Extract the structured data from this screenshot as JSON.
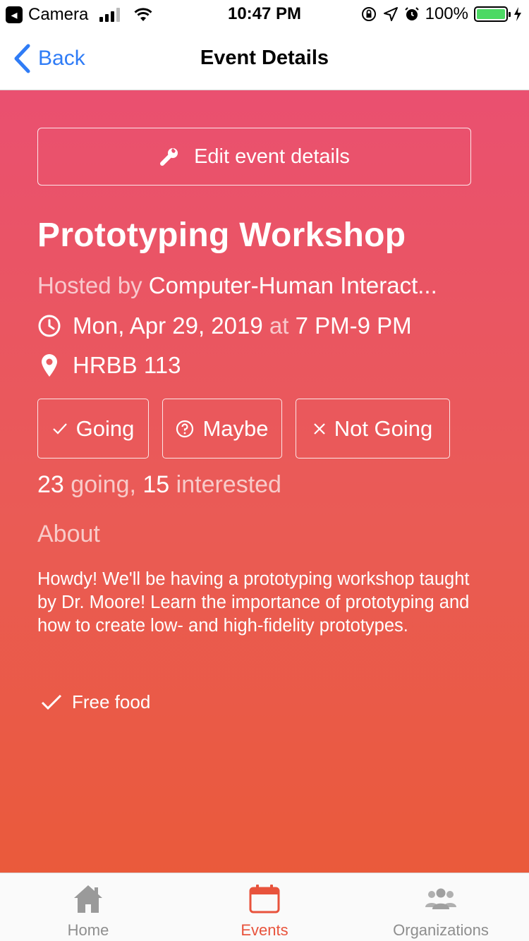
{
  "status_bar": {
    "back_app": "Camera",
    "time": "10:47 PM",
    "battery": "100%",
    "battery_level": 1.0
  },
  "nav": {
    "back_label": "Back",
    "title": "Event Details"
  },
  "event": {
    "edit_button": "Edit event details",
    "title": "Prototyping Workshop",
    "hosted_by_prefix": "Hosted by",
    "host": "Computer-Human Interact...",
    "date": "Mon, Apr 29, 2019",
    "at_word": "at",
    "time": "7 PM-9 PM",
    "location": "HRBB 113",
    "rsvp": {
      "going": "Going",
      "maybe": "Maybe",
      "not_going": "Not Going"
    },
    "going_count": "23",
    "going_word": "going,",
    "interested_count": "15",
    "interested_word": "interested",
    "about_heading": "About",
    "about_text": "Howdy! We'll be having a prototyping workshop taught by Dr. Moore! Learn the importance of prototyping and how to create low- and high-fidelity prototypes.",
    "tags": [
      "Free food"
    ]
  },
  "tab_bar": {
    "items": [
      {
        "label": "Home",
        "icon": "home-icon"
      },
      {
        "label": "Events",
        "icon": "calendar-icon"
      },
      {
        "label": "Organizations",
        "icon": "people-icon"
      }
    ],
    "active_index": 1
  },
  "colors": {
    "accent_blue": "#2f7cf6",
    "gradient_top": "#ea5070",
    "gradient_bottom": "#ea5a3b",
    "tab_active": "#e8533c",
    "tab_inactive": "#8e8e8e"
  }
}
